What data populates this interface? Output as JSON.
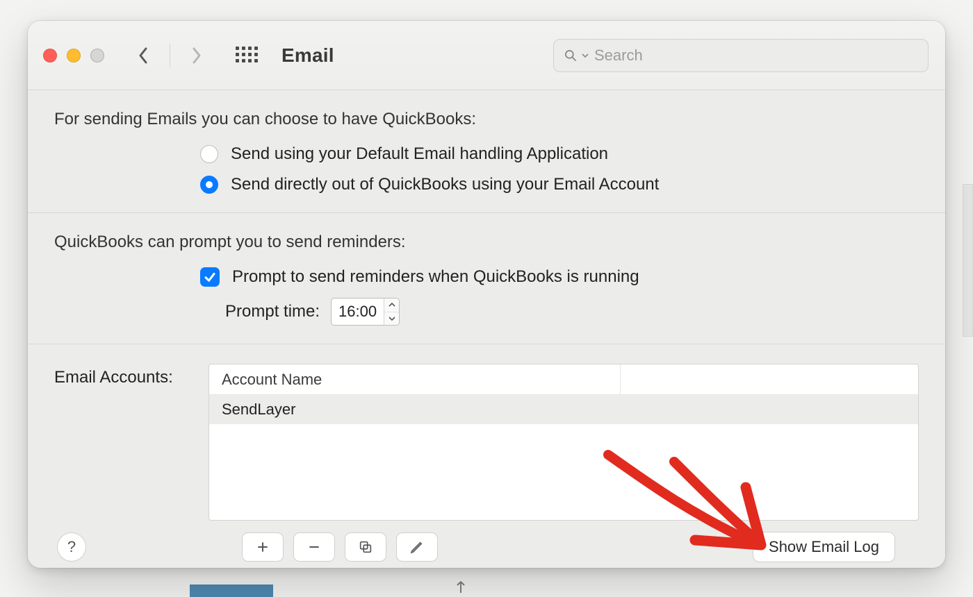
{
  "toolbar": {
    "title": "Email",
    "search_placeholder": "Search"
  },
  "section1": {
    "lead": "For sending Emails you can choose to have QuickBooks:",
    "option_default": "Send using your Default Email handling Application",
    "option_direct": "Send directly out of QuickBooks using your Email Account",
    "selected": "direct"
  },
  "section2": {
    "lead": "QuickBooks can prompt you to send reminders:",
    "checkbox_label": "Prompt to send reminders when QuickBooks is running",
    "checked": true,
    "time_label": "Prompt time:",
    "time_value": "16:00"
  },
  "accounts": {
    "label": "Email Accounts:",
    "header_col1": "Account Name",
    "rows": [
      "SendLayer"
    ]
  },
  "footer": {
    "help": "?",
    "show_log": "Show Email Log"
  }
}
